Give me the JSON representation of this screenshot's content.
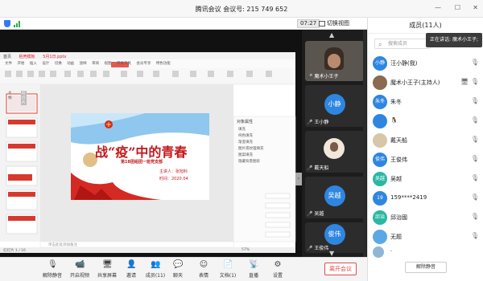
{
  "window": {
    "title": "腾讯会议 会议号: 215 749 652",
    "controls": [
      "—",
      "☐",
      "✕"
    ]
  },
  "meeting_bar": {
    "time": "07:27",
    "switch_view": "切换视图"
  },
  "share": {
    "app_tabs": [
      "首页",
      "稻壳模板",
      "5月1日.pptx"
    ],
    "menu": [
      "文件",
      "开始",
      "插入",
      "设计",
      "切换",
      "动画",
      "放映",
      "审阅",
      "视图",
      "开发工具",
      "会员专享",
      "特色功能"
    ],
    "sidebar_tabs": [
      "大纲",
      "幻灯片"
    ],
    "slide_title": "战“疫”中的青春",
    "slide_subtitle": "第18团组团一班党支部",
    "slide_presenter": "主讲人：张旭科",
    "slide_date": "时间：2020.04",
    "notes_placeholder": "单击此处添加备注",
    "status_left": "幻灯片 1 / 16",
    "zoom": "57%",
    "format_title": "对象属性",
    "format_items": [
      "填充",
      "纯色填充",
      "渐变填充",
      "图片或纹理填充",
      "图案填充",
      "隐藏背景图形"
    ]
  },
  "participants": [
    {
      "name": "魔术小王子",
      "type": "video"
    },
    {
      "name": "王小静",
      "avatar": "小静",
      "color": "#2e86e0"
    },
    {
      "name": "戴天船",
      "type": "photo"
    },
    {
      "name": "吴越",
      "avatar": "吴越",
      "color": "#2e86e0"
    },
    {
      "name": "王俊伟",
      "avatar": "俊伟",
      "color": "#2e86e0"
    }
  ],
  "toolbar": {
    "items": [
      "解除静音",
      "开启视频",
      "共享屏幕",
      "邀请",
      "成员(11)",
      "聊天",
      "表情",
      "文档(1)",
      "直播",
      "设置"
    ],
    "leave": "离开会议"
  },
  "panel": {
    "title": "成员(11人)",
    "search_placeholder": "搜索成员",
    "speaking": "正在讲话: 魔术小王子;",
    "members": [
      {
        "avatar": "小静",
        "name": "汪小静(我)",
        "color": "#2e86e0"
      },
      {
        "avatar": "",
        "name": "魔术小王子(主持人)",
        "color": "#8a6a50"
      },
      {
        "avatar": "朱冬",
        "name": "朱冬",
        "color": "#2e86e0"
      },
      {
        "avatar": "",
        "name": "🐧",
        "color": "#2e86e0"
      },
      {
        "avatar": "",
        "name": "戴天船",
        "color": "#d9c6a8"
      },
      {
        "avatar": "俊伟",
        "name": "王俊伟",
        "color": "#2e86e0"
      },
      {
        "avatar": "吴越",
        "name": "吴越",
        "color": "#2bb7a3"
      },
      {
        "avatar": "19",
        "name": "159****2419",
        "color": "#2e86e0"
      },
      {
        "avatar": "邱治",
        "name": "邱治國",
        "color": "#2bb7a3"
      },
      {
        "avatar": "",
        "name": "无题",
        "color": "#5aa9e6"
      },
      {
        "avatar": "",
        "name": "·",
        "color": "#8fb6d6"
      }
    ],
    "mute_all": "解除静音"
  }
}
